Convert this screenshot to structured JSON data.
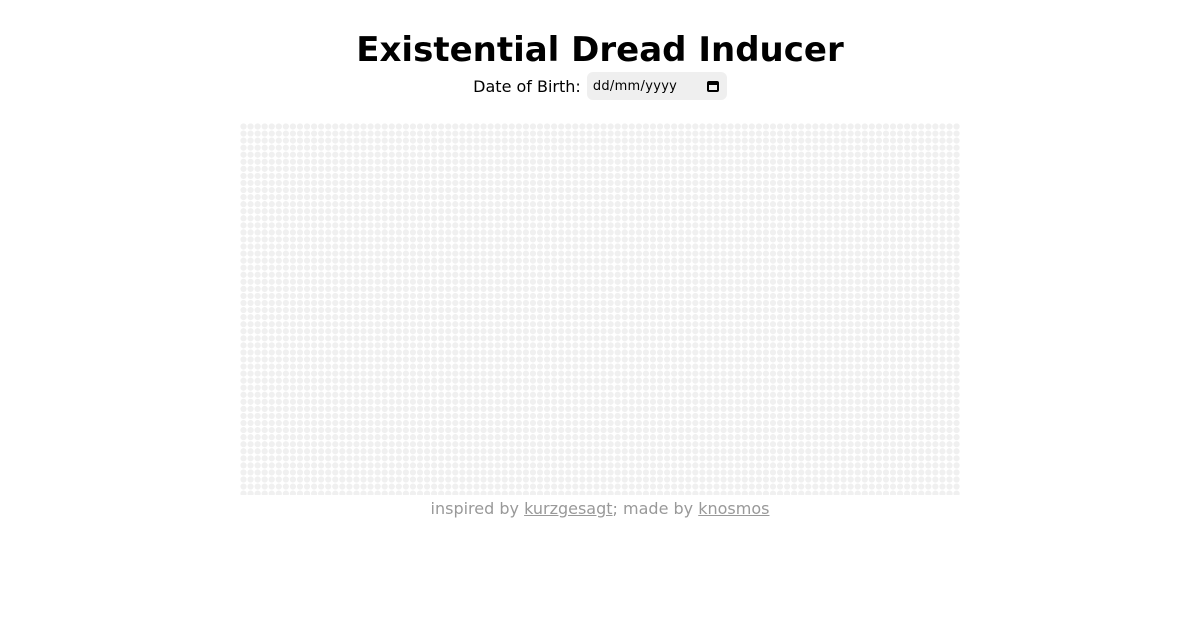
{
  "header": {
    "title": "Existential Dread Inducer"
  },
  "form": {
    "dob_label": "Date of Birth:",
    "dob_placeholder": "dd/mm/yyyy"
  },
  "grid": {
    "dot_color": "#f0f0f0",
    "filled_weeks": 0
  },
  "footer": {
    "prefix": "inspired by ",
    "link1": "kurzgesagt",
    "middle": "; made by ",
    "link2": "knosmos"
  }
}
